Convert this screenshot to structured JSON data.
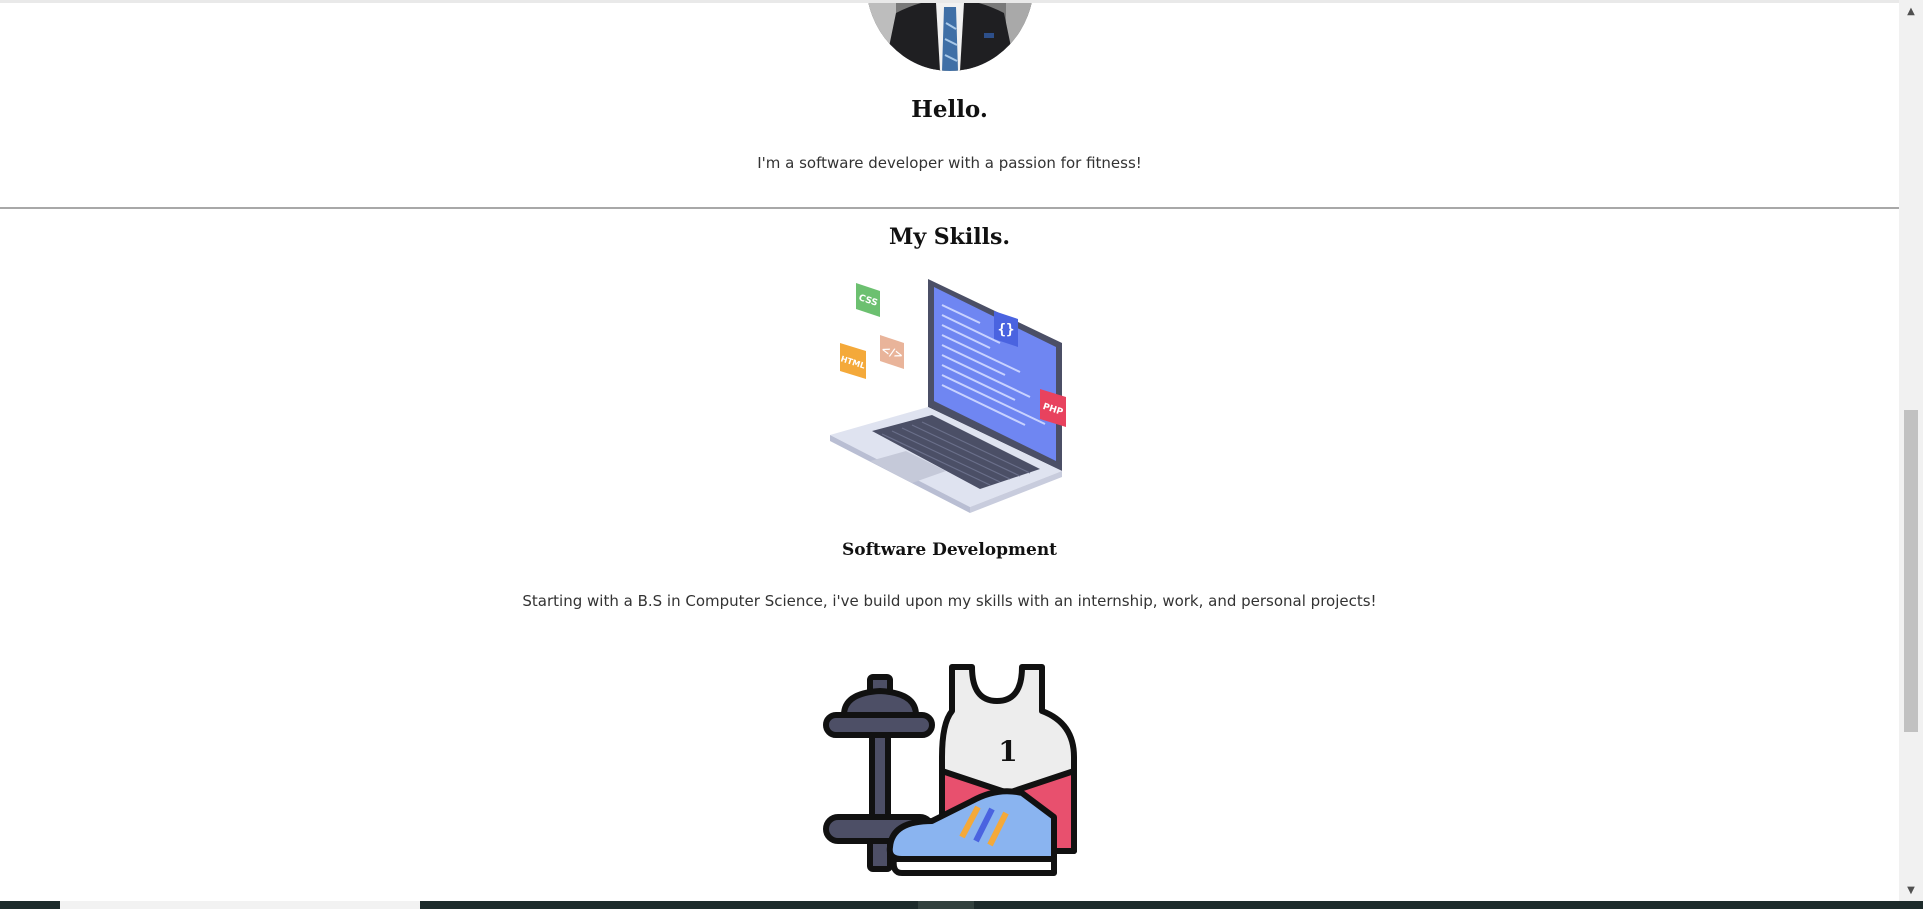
{
  "hello": {
    "title": "Hello.",
    "text": "I'm a software developer with a passion for fitness!"
  },
  "skills": {
    "title": "My Skills.",
    "items": [
      {
        "title": "Software Development",
        "text": "Starting with a B.S in Computer Science, i've build upon my skills with an internship, work, and personal projects!",
        "illustration_labels": [
          "CSS",
          "HTML",
          "</>",
          "{}",
          "PHP"
        ]
      },
      {
        "illustration_labels": [
          "1"
        ]
      }
    ]
  },
  "icons": {
    "profile": "profile-photo",
    "laptop": "laptop-code-icon",
    "fitness": "fitness-gear-icon",
    "scroll_up": "scroll-up-arrow-icon",
    "scroll_down": "scroll-down-arrow-icon"
  },
  "colors": {
    "background": "#ffffff",
    "divider": "#a8a8a8",
    "css_badge": "#6cc070",
    "html_badge": "#f4a93a",
    "code_badge": "#e9b49a",
    "braces_badge": "#4a63e0",
    "php_badge": "#e8425e",
    "laptop_screen": "#6f86f2",
    "tank_pink": "#e8506e",
    "shoe_blue": "#8ab4f0",
    "dumbbell": "#4d4f66"
  }
}
